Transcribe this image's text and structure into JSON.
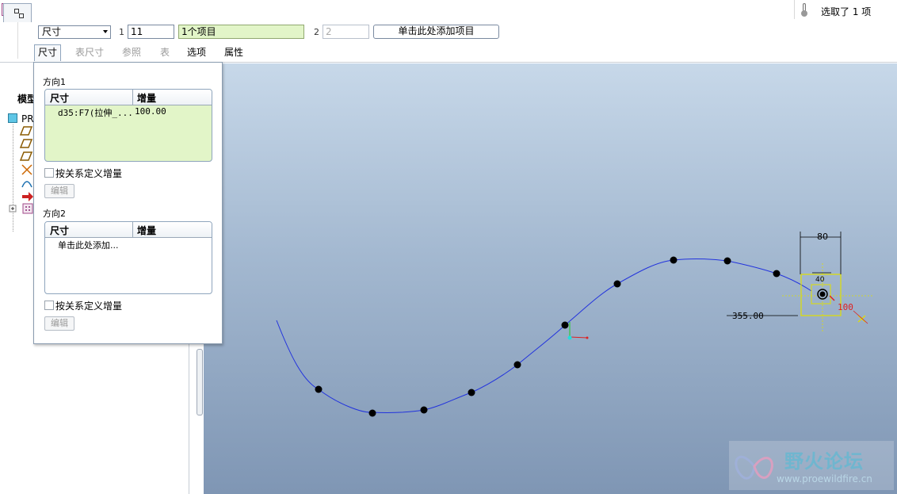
{
  "dashboard": {
    "type_dropdown": {
      "value": "尺寸"
    },
    "dir1": {
      "index": "1",
      "count": "11",
      "items": "1个项目"
    },
    "dir2": {
      "index": "2",
      "count": "2",
      "add_button": "单击此处添加项目"
    },
    "tabs": [
      {
        "label": "尺寸",
        "state": "active"
      },
      {
        "label": "表尺寸",
        "state": "disabled"
      },
      {
        "label": "参照",
        "state": "disabled"
      },
      {
        "label": "表",
        "state": "disabled"
      },
      {
        "label": "选项",
        "state": "enabled"
      },
      {
        "label": "属性",
        "state": "enabled"
      }
    ],
    "selection_status": "选取了 1 项"
  },
  "model_tree": {
    "header_partial": "模型",
    "root_label_partial": "PR",
    "icons": [
      "datum-plane-icon",
      "datum-plane-icon",
      "datum-plane-icon",
      "coordinate-system-icon",
      "datum-curve-icon",
      "insert-here-icon",
      "pattern-feature-icon"
    ]
  },
  "dimensions_panel": {
    "direction1": {
      "label": "方向1",
      "col_dimension": "尺寸",
      "col_increment": "增量",
      "rows": [
        {
          "dimension": "d35:F7(拉伸_...",
          "increment": "100.00"
        }
      ],
      "relation_checkbox": "按关系定义增量",
      "edit_button": "编辑"
    },
    "direction2": {
      "label": "方向2",
      "col_dimension": "尺寸",
      "col_increment": "增量",
      "placeholder": "单击此处添加...",
      "relation_checkbox": "按关系定义增量",
      "edit_button": "编辑"
    }
  },
  "graphics": {
    "dim_width": "80",
    "dim_inner": "40",
    "dim_increment": "100",
    "dim_offset": "355.00",
    "colors": {
      "curve": "#2233dd",
      "highlight": "#e0e000",
      "increment_text": "#e02020"
    }
  },
  "watermark": {
    "title": "野火论坛",
    "url": "www.proewildfire.cn"
  }
}
